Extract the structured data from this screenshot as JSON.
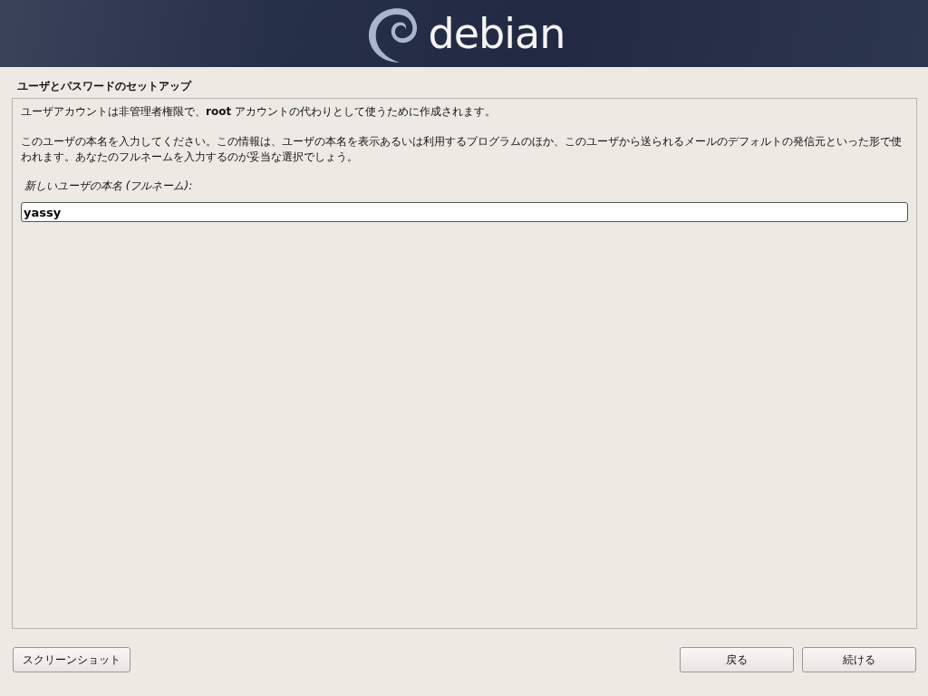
{
  "header": {
    "logo_text": "debian"
  },
  "title": "ユーザとパスワードのセットアップ",
  "paragraphs": [
    "ユーザアカウントは非管理者権限で、**root** アカウントの代わりとして使うために作成されます。",
    "このユーザの本名を入力してください。この情報は、ユーザの本名を表示あるいは利用するプログラムのほか、このユーザから送られるメールのデフォルトの発信元といった形で使われます。あなたのフルネームを入力するのが妥当な選択でしょう。"
  ],
  "field": {
    "label": "新しいユーザの本名 (フルネーム):",
    "value": "yassy"
  },
  "buttons": {
    "left": [
      "スクリーンショット"
    ],
    "right": [
      "戻る",
      "続ける"
    ]
  }
}
